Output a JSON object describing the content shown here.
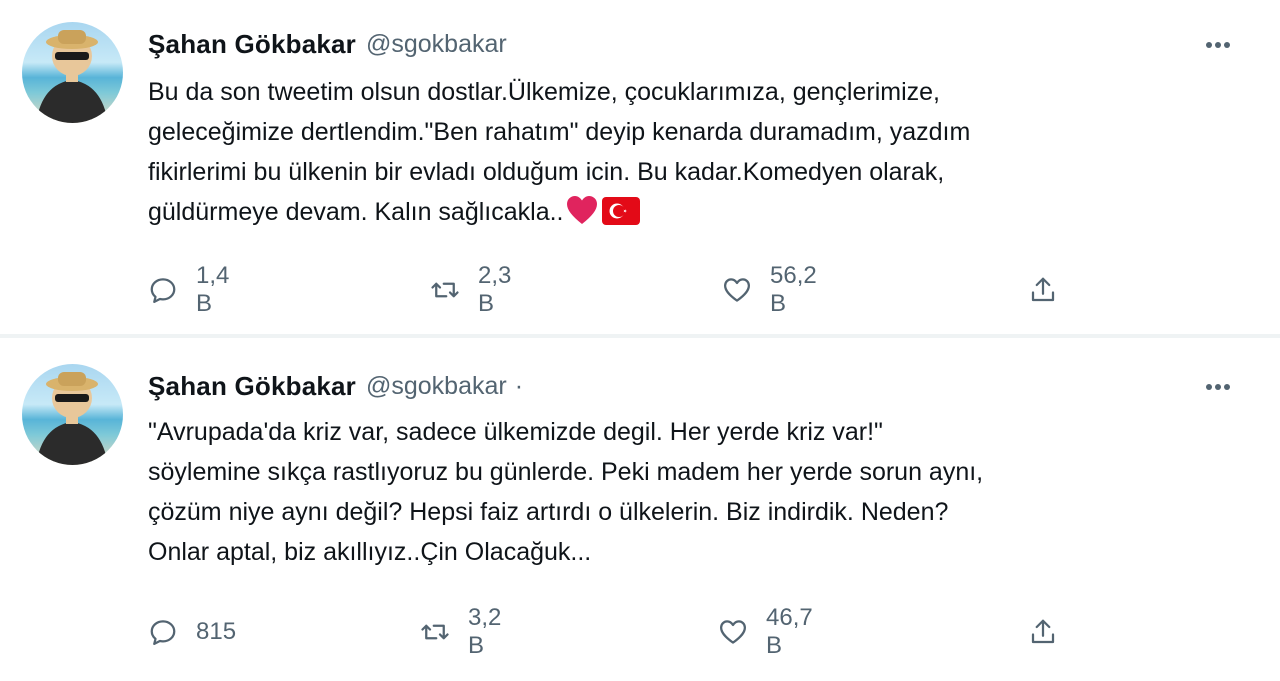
{
  "tweets": [
    {
      "author": {
        "name": "Şahan Gökbakar",
        "handle": "@sgokbakar",
        "separator": ""
      },
      "text": "Bu da son tweetim olsun dostlar.Ülkemize, çocuklarımıza, gençlerimize,\ngeleceğimize dertlendim.\"Ben rahatım\" deyip kenarda duramadım, yazdım\nfikirlerimi  bu ülkenin bir evladı olduğum icin. Bu kadar.Komedyen olarak,\ngüldürmeye devam. Kalın sağlıcakla..",
      "emojis": [
        "red-heart-icon",
        "turkey-flag-icon"
      ],
      "stats": {
        "replies": "1,4 B",
        "retweets": "2,3 B",
        "likes": "56,2 B"
      }
    },
    {
      "author": {
        "name": "Şahan Gökbakar",
        "handle": "@sgokbakar",
        "separator": "·"
      },
      "text": "\"Avrupada'da kriz var, sadece ülkemizde degil. Her yerde kriz var!\"\nsöylemine sıkça rastlıyoruz bu günlerde. Peki madem her yerde sorun aynı,\nçözüm niye aynı değil? Hepsi faiz artırdı o ülkelerin. Biz indirdik. Neden?\nOnlar aptal, biz akıllıyız..Çin Olacağuk...",
      "emojis": [],
      "stats": {
        "replies": "815",
        "retweets": "3,2 B",
        "likes": "46,7 B"
      }
    }
  ],
  "icons": {
    "reply": "reply-icon",
    "retweet": "retweet-icon",
    "like": "like-icon",
    "share": "share-icon",
    "more": "more-options-icon"
  },
  "colors": {
    "text": "#0f1419",
    "secondary": "#536471",
    "heart": "#e0245e",
    "flag": "#e30a17"
  }
}
